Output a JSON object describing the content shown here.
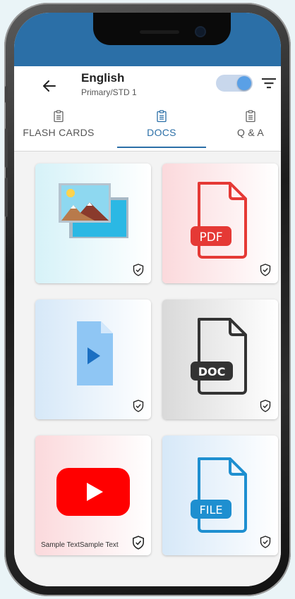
{
  "header": {
    "title": "English",
    "subtitle": "Primary/STD 1",
    "toggle_on": true
  },
  "tabs": [
    {
      "label": "FLASH CARDS",
      "active": false
    },
    {
      "label": "DOCS",
      "active": true
    },
    {
      "label": "Q & A",
      "active": false
    }
  ],
  "cards": [
    {
      "type": "image-icon",
      "caption": ""
    },
    {
      "type": "pdf-file-icon",
      "badge": "PDF",
      "caption": ""
    },
    {
      "type": "video-file-icon",
      "caption": ""
    },
    {
      "type": "doc-file-icon",
      "badge": "DOC",
      "caption": ""
    },
    {
      "type": "youtube-icon",
      "caption": "Sample TextSample Text"
    },
    {
      "type": "generic-file-icon",
      "badge": "FILE",
      "caption": ""
    }
  ],
  "colors": {
    "primary": "#2b6fa7",
    "pdf": "#e53935",
    "doc": "#333333",
    "file": "#1e8fd0",
    "youtube": "#ff0000"
  }
}
